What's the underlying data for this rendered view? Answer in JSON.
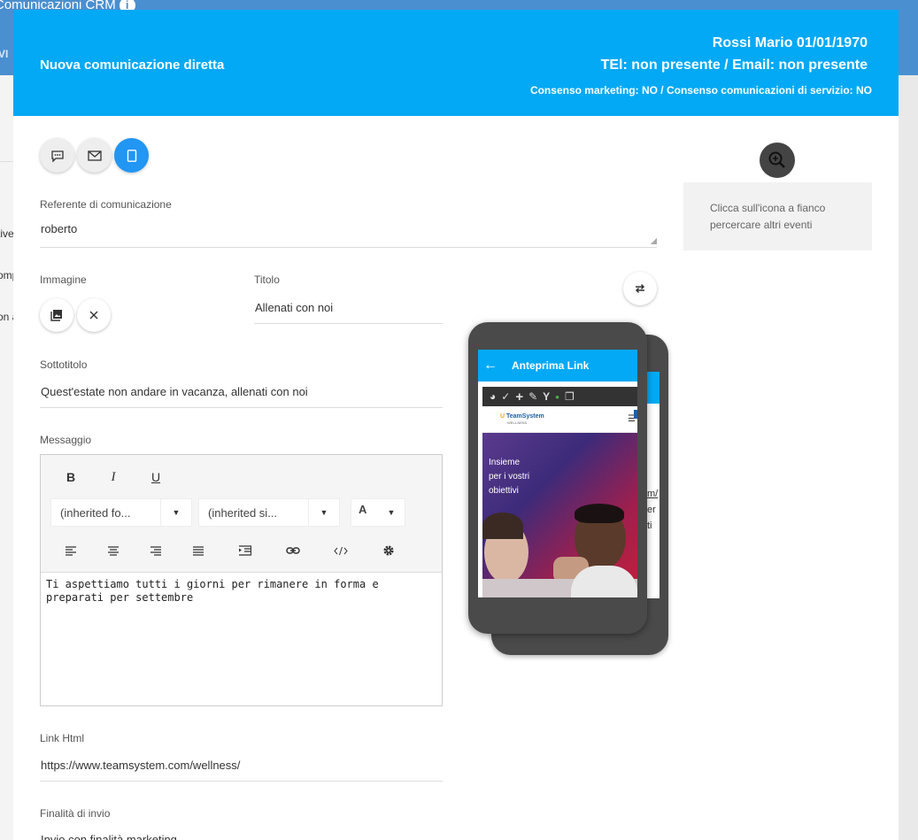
{
  "background": {
    "app_title": "Comunicazioni CRM",
    "vi_fragment": "VI",
    "side_fragments": [
      "tive",
      "omp",
      "on a"
    ]
  },
  "header": {
    "title": "Nuova comunicazione diretta",
    "patient": "Rossi Mario 01/01/1970",
    "contacts": "TEl: non presente / Email: non presente",
    "consent": "Consenso marketing: NO / Consenso comunicazioni di servizio: NO"
  },
  "channels": [
    {
      "icon": "chat-icon",
      "active": false
    },
    {
      "icon": "email-icon",
      "active": false
    },
    {
      "icon": "mobile-icon",
      "active": true
    }
  ],
  "form": {
    "referente_label": "Referente di comunicazione",
    "referente_value": "roberto",
    "immagine_label": "Immagine",
    "titolo_label": "Titolo",
    "titolo_value": "Allenati con noi",
    "sottotitolo_label": "Sottotitolo",
    "sottotitolo_value": "Quest'estate non andare in vacanza, allenati con noi",
    "messaggio_label": "Messaggio",
    "messaggio_value": "Ti aspettiamo tutti i giorni per rimanere in forma e preparati per settembre",
    "link_label": "Link Html",
    "link_value": "https://www.teamsystem.com/wellness/",
    "finalita_label": "Finalità di invio",
    "finalita_value": "Invio con finalità marketing"
  },
  "editor": {
    "bold": "B",
    "italic": "I",
    "underline": "U",
    "font_family": "(inherited fo...",
    "font_size": "(inherited si...",
    "font_color": "A"
  },
  "preview": {
    "hint": "Clicca sull'icona a fianco percercare altri eventi",
    "phone_title": "Anteprima Link",
    "brand": "TeamSystem",
    "brand_sub": "WELLNESS",
    "hero_lines": [
      "Insieme",
      "per i vostri",
      "obiettivi"
    ],
    "back_fragments": [
      "m/",
      "er",
      "ti"
    ]
  },
  "colors": {
    "header": "#03a9f4",
    "active_channel": "#2196f3"
  }
}
